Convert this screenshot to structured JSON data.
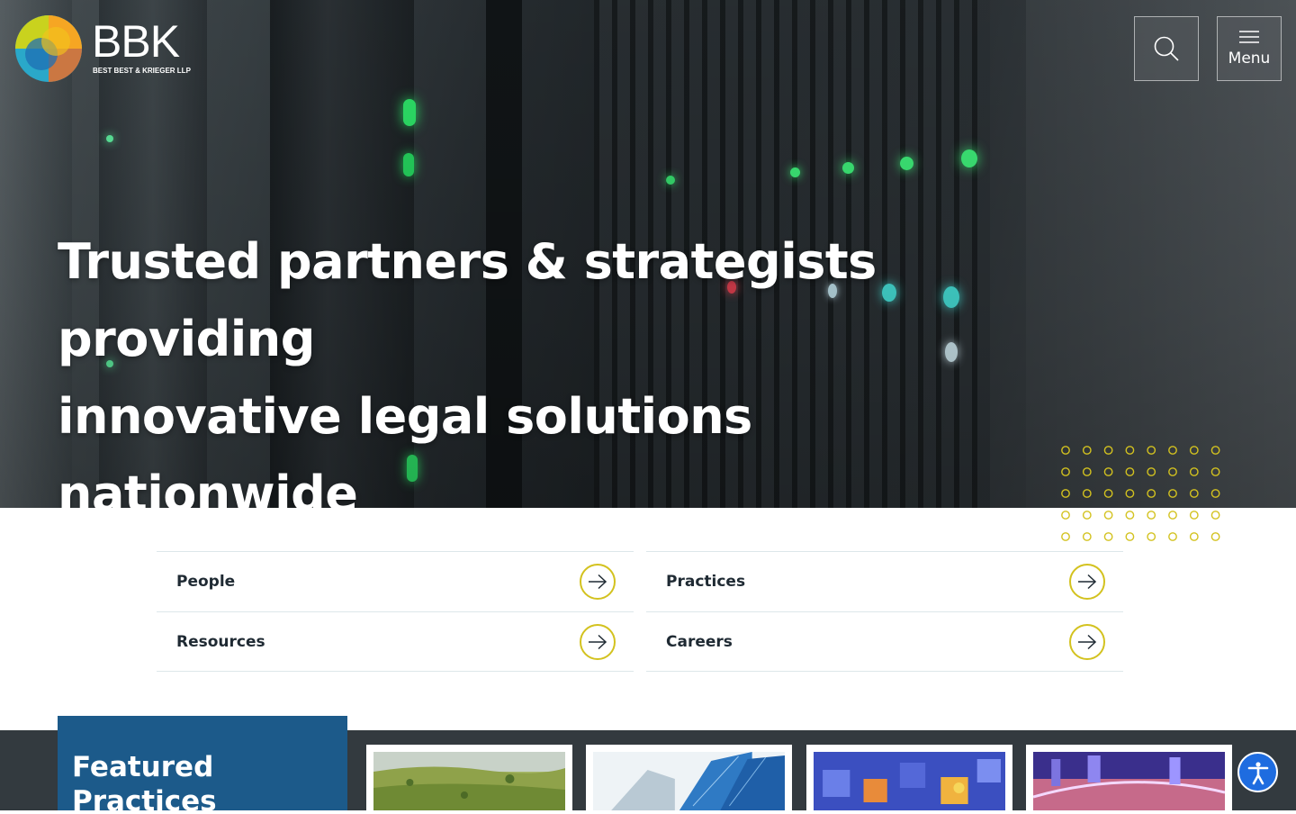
{
  "header": {
    "logo_text": "BBK",
    "logo_subtext": "BEST BEST & KRIEGER LLP",
    "search_icon": "search-icon",
    "menu_icon": "hamburger-icon",
    "menu_label": "Menu"
  },
  "hero": {
    "headline_line1": "Trusted partners & strategists providing",
    "headline_line2": "innovative legal solutions nationwide",
    "accent_color": "#d3c21f"
  },
  "quick_links": [
    {
      "label": "People",
      "icon": "arrow-right-icon"
    },
    {
      "label": "Practices",
      "icon": "arrow-right-icon"
    },
    {
      "label": "Resources",
      "icon": "arrow-right-icon"
    },
    {
      "label": "Careers",
      "icon": "arrow-right-icon"
    }
  ],
  "featured": {
    "title_line1": "Featured",
    "title_line2": "Practices",
    "title_bg": "#1c5a8a",
    "cards": [
      {
        "image": "landscape-image"
      },
      {
        "image": "skyscrapers-image"
      },
      {
        "image": "network-blocks-image"
      },
      {
        "image": "digital-city-image"
      }
    ]
  },
  "accessibility": {
    "icon": "accessibility-icon",
    "color": "#1e6ce0"
  }
}
